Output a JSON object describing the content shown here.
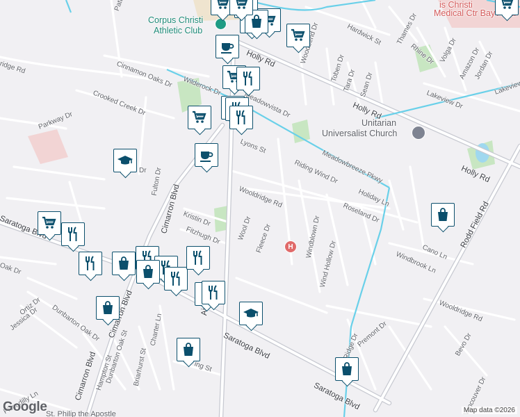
{
  "map": {
    "credit": "Map data ©2026",
    "logo": "Google",
    "road_labels": [
      {
        "text": "Holly Rd",
        "major": true
      },
      {
        "text": "Holly Rd",
        "major": true
      },
      {
        "text": "Holly Rd",
        "major": true
      },
      {
        "text": "Saratoga Blvd",
        "major": true
      },
      {
        "text": "Saratoga Blvd",
        "major": true
      },
      {
        "text": "Saratoga Blvd",
        "major": true
      },
      {
        "text": "Rodd Field Rd",
        "major": true
      },
      {
        "text": "Airline Rd",
        "major": true
      },
      {
        "text": "Cimarron Blvd",
        "major": true
      },
      {
        "text": "Cimarron Blvd",
        "major": true
      },
      {
        "text": "Cimarron Blvd",
        "major": true
      },
      {
        "text": "Wooldridge Rd",
        "major": false
      },
      {
        "text": "Wooldridge Rd",
        "major": false
      },
      {
        "text": "Meadowbreeze Pkwy",
        "major": false
      },
      {
        "text": "Riding Wind Dr",
        "major": false
      },
      {
        "text": "Lyons St",
        "major": false
      },
      {
        "text": "Wilderock Dr",
        "major": false
      },
      {
        "text": "Meadowvista Dr",
        "major": false
      },
      {
        "text": "Cinnamon Oaks Dr",
        "major": false
      },
      {
        "text": "Crooked Creek Dr",
        "major": false
      },
      {
        "text": "Parkway Dr",
        "major": false
      },
      {
        "text": "Fulton Dr",
        "major": false
      },
      {
        "text": "Kristin Dr",
        "major": false
      },
      {
        "text": "Fitzhugh Dr",
        "major": false
      },
      {
        "text": "Wool Dr",
        "major": false
      },
      {
        "text": "Fleece Dr",
        "major": false
      },
      {
        "text": "Windblown Dr",
        "major": false
      },
      {
        "text": "Wind Hollow Dr",
        "major": false
      },
      {
        "text": "Roseland Dr",
        "major": false
      },
      {
        "text": "Holiday Ln",
        "major": false
      },
      {
        "text": "Cano Ln",
        "major": false
      },
      {
        "text": "Windbrook Ln",
        "major": false
      },
      {
        "text": "Lakeview Dr",
        "major": false
      },
      {
        "text": "Hardwick St",
        "major": false
      },
      {
        "text": "Woodbend Dr",
        "major": false
      },
      {
        "text": "Toben Dr",
        "major": false
      },
      {
        "text": "Tara Dr",
        "major": false
      },
      {
        "text": "Sean Dr",
        "major": false
      },
      {
        "text": "Thames Dr",
        "major": false
      },
      {
        "text": "Rhine Dr",
        "major": false
      },
      {
        "text": "Volga Dr",
        "major": false
      },
      {
        "text": "Amazon Dr",
        "major": false
      },
      {
        "text": "Jordan Dr",
        "major": false
      },
      {
        "text": "Lakeview",
        "major": false
      },
      {
        "text": "Ortiz Dr",
        "major": false
      },
      {
        "text": "Jessica Dr",
        "major": false
      },
      {
        "text": "Dunbarton Oak Dr",
        "major": false
      },
      {
        "text": "Dunbarton Oak St",
        "major": false
      },
      {
        "text": "Hampton St",
        "major": false
      },
      {
        "text": "Briarhurst St",
        "major": false
      },
      {
        "text": "Charter Ln",
        "major": false
      },
      {
        "text": "Sunny Ridge Dr",
        "major": false
      },
      {
        "text": "Premont Dr",
        "major": false
      },
      {
        "text": "Bevo Dr",
        "major": false
      },
      {
        "text": "Vancouver Dr",
        "major": false
      },
      {
        "text": "Piccadilly Ln",
        "major": false
      },
      {
        "text": "Dr",
        "major": false
      },
      {
        "text": "Oak Dr",
        "major": false
      },
      {
        "text": "ing St",
        "major": false
      },
      {
        "text": "Patti",
        "major": false
      },
      {
        "text": "ridge Rd",
        "major": false
      }
    ],
    "places": [
      {
        "text": "Corpus Christi",
        "color": "#1e8a78"
      },
      {
        "text": "Athletic Club",
        "color": "#1e8a78"
      },
      {
        "text": "Unitarian",
        "color": "#5f6168"
      },
      {
        "text": "Universalist Church",
        "color": "#5f6168"
      },
      {
        "text": "is Christi",
        "color": "#d35a5a"
      },
      {
        "text": "Medical Ctr Bay Area",
        "color": "#d35a5a"
      },
      {
        "text": "St. Philip the Apostle",
        "color": "#5f6168"
      }
    ],
    "markers": [
      "shopping-cart-icon",
      "shopping-bag-icon",
      "shopping-cart-icon",
      "shopping-cart-icon",
      "coffee-icon",
      "shopping-cart-icon",
      "shopping-cart-icon",
      "restaurant-icon",
      "shopping-cart-icon",
      "restaurant-icon",
      "restaurant-icon",
      "school-icon",
      "shopping-bag-icon",
      "shopping-cart-icon",
      "coffee-icon",
      "shopping-cart-icon",
      "restaurant-icon",
      "restaurant-icon",
      "shopping-bag-icon",
      "restaurant-icon",
      "restaurant-icon",
      "restaurant-icon",
      "shopping-bag-icon",
      "restaurant-icon",
      "restaurant-icon",
      "restaurant-icon",
      "school-icon",
      "shopping-bag-icon",
      "shopping-cart-icon",
      "shopping-bag-icon"
    ],
    "colors": {
      "background": "#f1f0f3",
      "water_line": "#69d0e9",
      "park": "#c8e6c2",
      "marker_border": "#0b4f6c",
      "hospital": "#e06a6a"
    }
  }
}
